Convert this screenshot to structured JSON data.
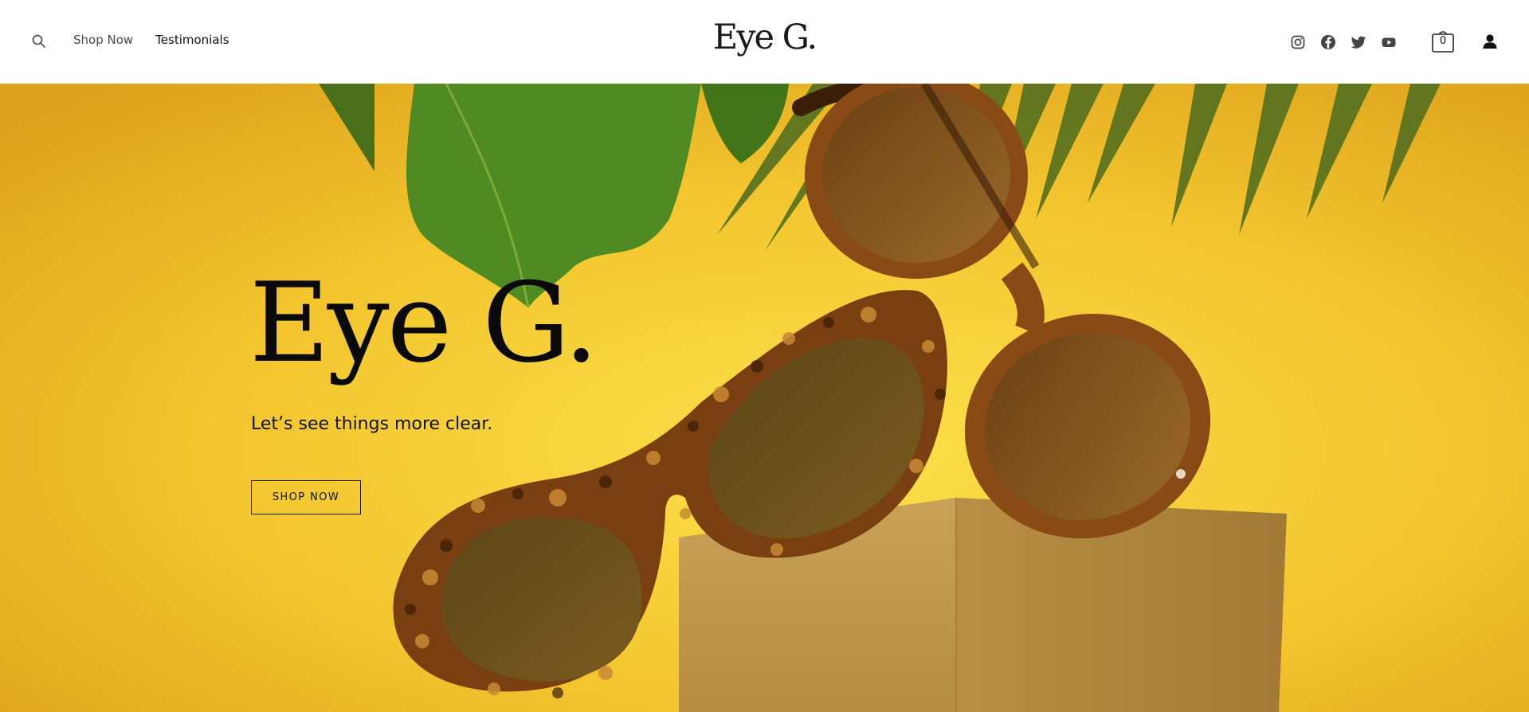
{
  "header": {
    "logo_text": "Eye G.",
    "nav": [
      {
        "label": "Shop Now"
      },
      {
        "label": "Testimonials"
      }
    ],
    "social": [
      "instagram-icon",
      "facebook-icon",
      "twitter-icon",
      "youtube-icon"
    ],
    "cart": {
      "count": "0"
    }
  },
  "hero": {
    "title": "Eye G.",
    "subtitle": "Let’s see things more clear.",
    "cta_label": "SHOP NOW"
  },
  "colors": {
    "hero_background": "#f2c02d",
    "leaf_green": "#3b7a1f",
    "tortoise": "#7a3f10",
    "lens": "#6b4e1a",
    "box": "#c9a45a"
  }
}
